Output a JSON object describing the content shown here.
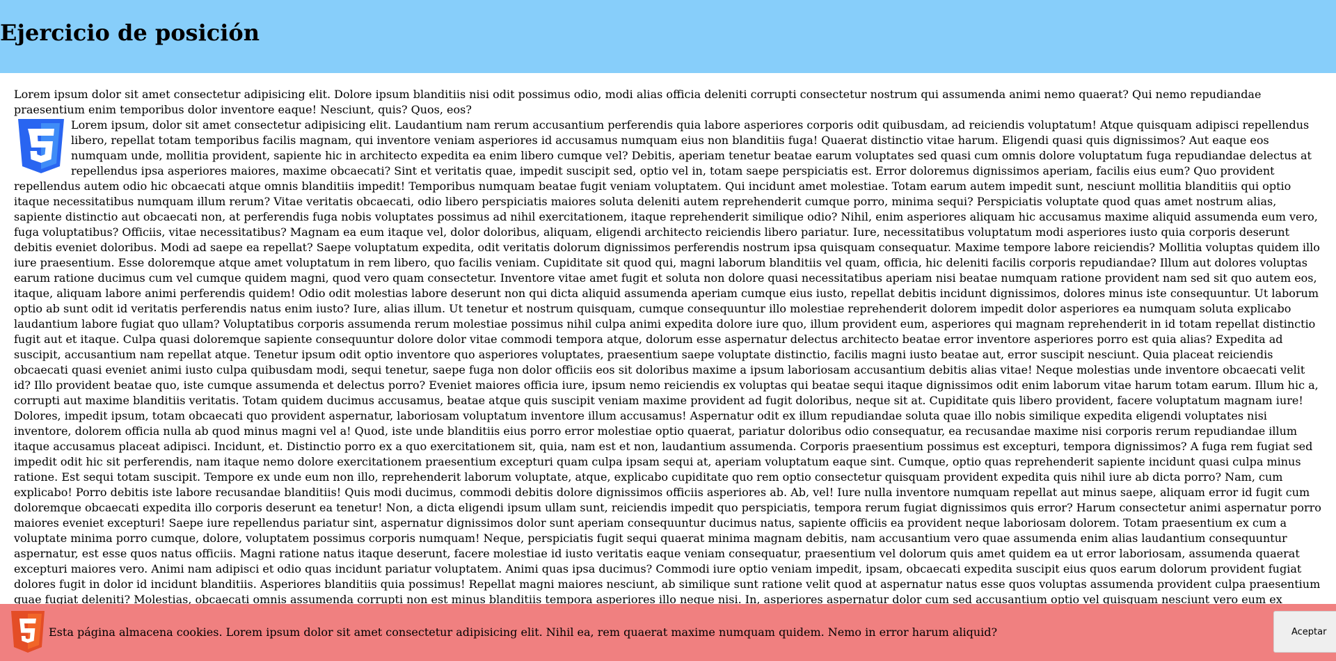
{
  "header": {
    "title": "Ejercicio de posición"
  },
  "main": {
    "paragraph1": "Lorem ipsum dolor sit amet consectetur adipisicing elit. Dolore ipsum blanditiis nisi odit possimus odio, modi alias officia deleniti corrupti consectetur nostrum qui assumenda animi nemo quaerat? Qui nemo repudiandae praesentium enim temporibus dolor inventore eaque! Nesciunt, quis? Quos, eos?",
    "logo_icon": "css3-shield-icon",
    "paragraph2": "Lorem ipsum, dolor sit amet consectetur adipisicing elit. Laudantium nam rerum accusantium perferendis quia labore asperiores corporis odit quibusdam, ad reiciendis voluptatum! Atque quisquam adipisci repellendus libero, repellat totam temporibus facilis magnam, qui inventore veniam asperiores id accusamus numquam eius non blanditiis fuga! Quaerat distinctio vitae harum. Eligendi quasi quis dignissimos? Aut eaque eos numquam unde, mollitia provident, sapiente hic in architecto expedita ea enim libero cumque vel? Debitis, aperiam tenetur beatae earum voluptates sed quasi cum omnis dolore voluptatum fuga repudiandae delectus at repellendus ipsa asperiores maiores, maxime obcaecati? Sint et veritatis quae, impedit suscipit sed, optio vel in, totam saepe perspiciatis est. Error doloremus dignissimos aperiam, facilis eius eum? Quo provident repellendus autem odio hic obcaecati atque omnis blanditiis impedit! Temporibus numquam beatae fugit veniam voluptatem. Qui incidunt amet molestiae. Totam earum autem impedit sunt, nesciunt mollitia blanditiis qui optio itaque necessitatibus numquam illum rerum? Vitae veritatis obcaecati, odio libero perspiciatis maiores soluta deleniti autem reprehenderit cumque porro, minima sequi? Perspiciatis voluptate quod quas amet nostrum alias, sapiente distinctio aut obcaecati non, at perferendis fuga nobis voluptates possimus ad nihil exercitationem, itaque reprehenderit similique odio? Nihil, enim asperiores aliquam hic accusamus maxime aliquid assumenda eum vero, fuga voluptatibus? Officiis, vitae necessitatibus? Magnam ea eum itaque vel, dolor doloribus, aliquam, eligendi architecto reiciendis libero pariatur. Iure, necessitatibus voluptatum modi asperiores iusto quia corporis deserunt debitis eveniet doloribus. Modi ad saepe ea repellat? Saepe voluptatum expedita, odit veritatis dolorum dignissimos perferendis nostrum ipsa quisquam consequatur. Maxime tempore labore reiciendis? Mollitia voluptas quidem illo iure praesentium. Esse doloremque atque amet voluptatum in rem libero, quo facilis veniam. Cupiditate sit quod qui, magni laborum blanditiis vel quam, officia, hic deleniti facilis corporis repudiandae? Illum aut dolores voluptas earum ratione ducimus cum vel cumque quidem magni, quod vero quam consectetur. Inventore vitae amet fugit et soluta non dolore quasi necessitatibus aperiam nisi beatae numquam ratione provident nam sed sit quo autem eos, itaque, aliquam labore animi perferendis quidem! Odio odit molestias labore deserunt non qui dicta aliquid assumenda aperiam cumque eius iusto, repellat debitis incidunt dignissimos, dolores minus iste consequuntur. Ut laborum optio ab sunt odit id veritatis perferendis natus enim iusto? Iure, alias illum. Ut tenetur et nostrum quisquam, cumque consequuntur illo molestiae reprehenderit dolorem impedit dolor asperiores ea numquam soluta explicabo laudantium labore fugiat quo ullam? Voluptatibus corporis assumenda rerum molestiae possimus nihil culpa animi expedita dolore iure quo, illum provident eum, asperiores qui magnam reprehenderit in id totam repellat distinctio fugit aut et itaque. Culpa quasi doloremque sapiente consequuntur dolore dolor vitae commodi tempora atque, dolorum esse aspernatur delectus architecto beatae error inventore asperiores porro est quia alias? Expedita ad suscipit, accusantium nam repellat atque. Tenetur ipsum odit optio inventore quo asperiores voluptates, praesentium saepe voluptate distinctio, facilis magni iusto beatae aut, error suscipit nesciunt. Quia placeat reiciendis obcaecati quasi eveniet animi iusto culpa quibusdam modi, sequi tenetur, saepe fuga non dolor officiis eos sit doloribus maxime a ipsum laboriosam accusantium debitis alias vitae! Neque molestias unde inventore obcaecati velit id? Illo provident beatae quo, iste cumque assumenda et delectus porro? Eveniet maiores officia iure, ipsum nemo reiciendis ex voluptas qui beatae sequi itaque dignissimos odit enim laborum vitae harum totam earum. Illum hic a, corrupti aut maxime blanditiis veritatis. Totam quidem ducimus accusamus, beatae atque quis suscipit veniam maxime provident ad fugit doloribus, neque sit at. Cupiditate quis libero provident, facere voluptatum magnam iure! Dolores, impedit ipsum, totam obcaecati quo provident aspernatur, laboriosam voluptatum inventore illum accusamus! Aspernatur odit ex illum repudiandae soluta quae illo nobis similique expedita eligendi voluptates nisi inventore, dolorem officia nulla ab quod minus magni vel a! Quod, iste unde blanditiis eius porro error molestiae optio quaerat, pariatur doloribus odio consequatur, ea recusandae maxime nisi corporis rerum repudiandae illum itaque accusamus placeat adipisci. Incidunt, et. Distinctio porro ex a quo exercitationem sit, quia, nam est et non, laudantium assumenda. Corporis praesentium possimus est excepturi, tempora dignissimos? A fuga rem fugiat sed impedit odit hic sit perferendis, nam itaque nemo dolore exercitationem praesentium excepturi quam culpa ipsam sequi at, aperiam voluptatum eaque sint. Cumque, optio quas reprehenderit sapiente incidunt quasi culpa minus ratione. Est sequi totam suscipit. Tempore ex unde eum non illo, reprehenderit laborum voluptate, atque, explicabo cupiditate quo rem optio consectetur quisquam provident expedita quis nihil iure ab dicta porro? Nam, cum explicabo! Porro debitis iste labore recusandae blanditiis! Quis modi ducimus, commodi debitis dolore dignissimos officiis asperiores ab. Ab, vel! Iure nulla inventore numquam repellat aut minus saepe, aliquam error id fugit cum doloremque obcaecati expedita illo corporis deserunt ea tenetur! Non, a dicta eligendi ipsum ullam sunt, reiciendis impedit quo perspiciatis, tempora rerum fugiat dignissimos quis error? Harum consectetur animi aspernatur porro maiores eveniet excepturi! Saepe iure repellendus pariatur sint, aspernatur dignissimos dolor sunt aperiam consequuntur ducimus natus, sapiente officiis ea provident neque laboriosam dolorem. Totam praesentium ex cum a voluptate minima porro cumque, dolore, voluptatem possimus corporis numquam! Neque, perspiciatis fugit sequi quaerat minima magnam debitis, nam accusantium vero quae assumenda enim alias laudantium consequuntur aspernatur, est esse quos natus officiis. Magni ratione natus itaque deserunt, facere molestiae id iusto veritatis eaque veniam consequatur, praesentium vel dolorum quis amet quidem ea ut error laboriosam, assumenda quaerat excepturi maiores vero. Animi nam adipisci et odio quas incidunt pariatur voluptatem. Animi quas ipsa ducimus? Commodi iure optio veniam impedit, ipsam, obcaecati expedita suscipit eius quos earum dolorum provident fugiat dolores fugit in dolor id incidunt blanditiis. Asperiores blanditiis quia possimus! Repellat magni maiores nesciunt, ab similique sunt ratione velit quod at aspernatur natus esse quos voluptas assumenda provident culpa praesentium quae fugiat deleniti? Molestias, obcaecati omnis assumenda corrupti non est minus blanditiis tempora asperiores illo neque nisi. In, asperiores aspernatur dolor cum sed accusantium optio vel quisquam nesciunt vero eum ex molestiae eligendi aliquam inventore illo, sequi facere necessitatibus nihil beatae et magni? Fugiat rerum eligendi repudiandae nesciunt, debitis corrupti provident dolorem, repellendus molestiae neque officiis suscipit consequuntur corporis perferendis autem hic harum deleniti eveniet maxime dolores expedita sunt quaerat iure totam! Provident vel non perspiciatis tempora architecto aliquam minima officiis deserunt placeat eaque consectetur excepturi, nam error"
  },
  "cookie_bar": {
    "logo_icon": "html5-shield-icon",
    "text": "Esta página almacena cookies. Lorem ipsum dolor sit amet consectetur adipisicing elit. Nihil ea, rem quaerat maxime numquam quidem. Nemo in error harum aliquid?",
    "accept_label": "Aceptar"
  },
  "colors": {
    "header_bg": "#87cefa",
    "cookie_bg": "#f08080",
    "css3_blue": "#2965f1",
    "html5_orange": "#e44d26"
  }
}
